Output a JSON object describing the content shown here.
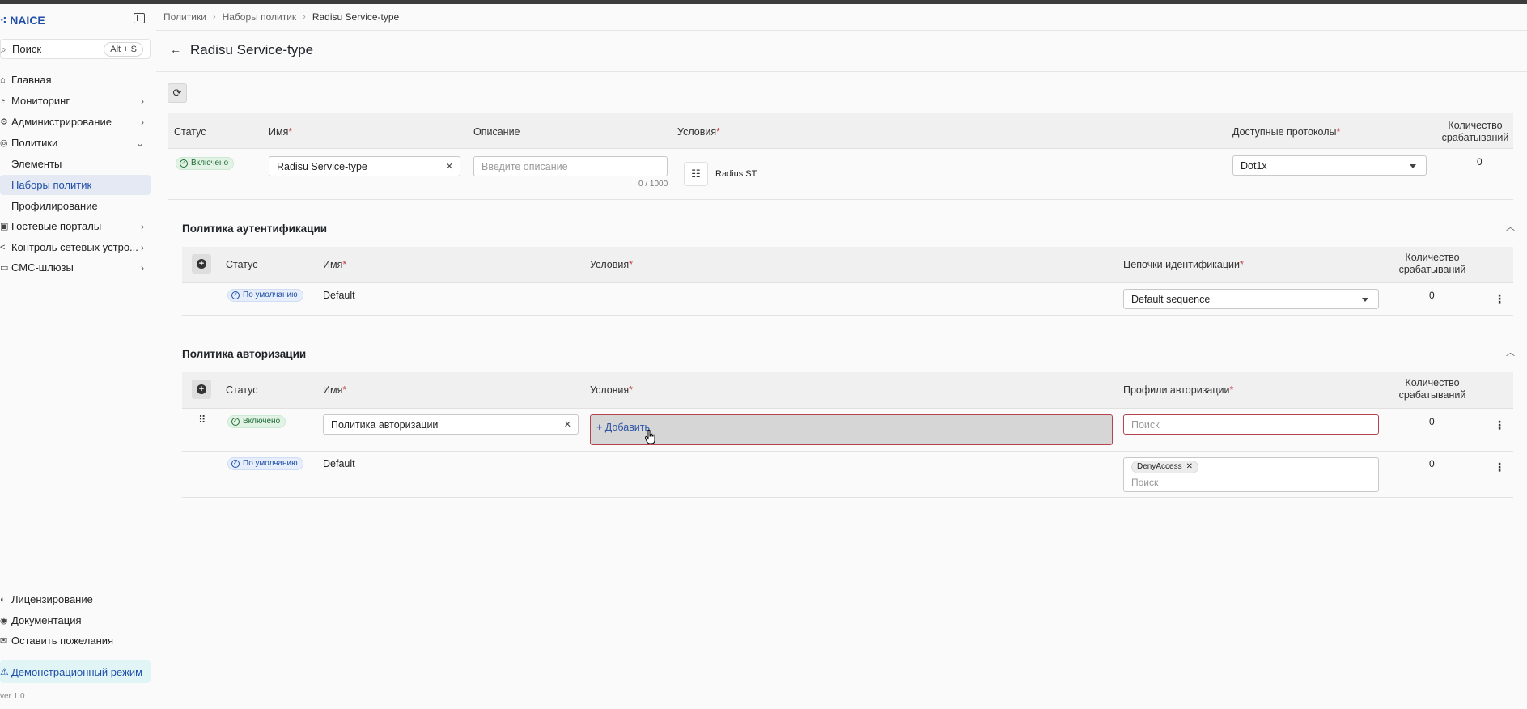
{
  "app": {
    "name": "NAICE",
    "version": "ver 1.0"
  },
  "sidebar": {
    "search_label": "Поиск",
    "search_shortcut": "Alt + S",
    "items": [
      {
        "label": "Главная"
      },
      {
        "label": "Мониторинг"
      },
      {
        "label": "Администрирование"
      },
      {
        "label": "Политики"
      },
      {
        "label": "Элементы"
      },
      {
        "label": "Наборы политик"
      },
      {
        "label": "Профилирование"
      },
      {
        "label": "Гостевые порталы"
      },
      {
        "label": "Контроль сетевых устро..."
      },
      {
        "label": "СМС-шлюзы"
      }
    ],
    "bottom_items": [
      {
        "label": "Лицензирование"
      },
      {
        "label": "Документация"
      },
      {
        "label": "Оставить пожелания"
      }
    ],
    "demo_mode": "Демонстрационный режим"
  },
  "breadcrumb": [
    "Политики",
    "Наборы политик",
    "Radisu Service-type"
  ],
  "page_title": "Radisu Service-type",
  "policy_set": {
    "headers": {
      "status": "Статус",
      "name": "Имя",
      "description": "Описание",
      "conditions": "Условия",
      "protocols": "Доступные протоколы",
      "hits": "Количество срабатываний"
    },
    "row": {
      "status": "Включено",
      "name": "Radisu Service-type",
      "description_placeholder": "Введите описание",
      "description_counter": "0 / 1000",
      "condition": "Radius ST",
      "protocol": "Dot1x",
      "hits": "0"
    }
  },
  "auth_policy": {
    "title": "Политика аутентификации",
    "headers": {
      "status": "Статус",
      "name": "Имя",
      "conditions": "Условия",
      "chains": "Цепочки идентификации",
      "hits": "Количество срабатываний"
    },
    "rows": [
      {
        "status": "По умолчанию",
        "name": "Default",
        "chain": "Default sequence",
        "hits": "0"
      }
    ]
  },
  "authz_policy": {
    "title": "Политика авторизации",
    "headers": {
      "status": "Статус",
      "name": "Имя",
      "conditions": "Условия",
      "profiles": "Профили авторизации",
      "hits": "Количество срабатываний"
    },
    "rows": [
      {
        "status": "Включено",
        "name": "Политика авторизации",
        "add_label": "Добавить",
        "profile_placeholder": "Поиск",
        "hits": "0"
      },
      {
        "status": "По умолчанию",
        "name": "Default",
        "profile_tag": "DenyAccess",
        "profile_placeholder": "Поиск",
        "hits": "0"
      }
    ]
  },
  "colors": {
    "accent": "#1f4fa8",
    "required": "#c43a46",
    "enabled_badge": "#e2f3e6",
    "default_badge": "#e6eefb",
    "demo_bg": "#e1f4f6"
  }
}
